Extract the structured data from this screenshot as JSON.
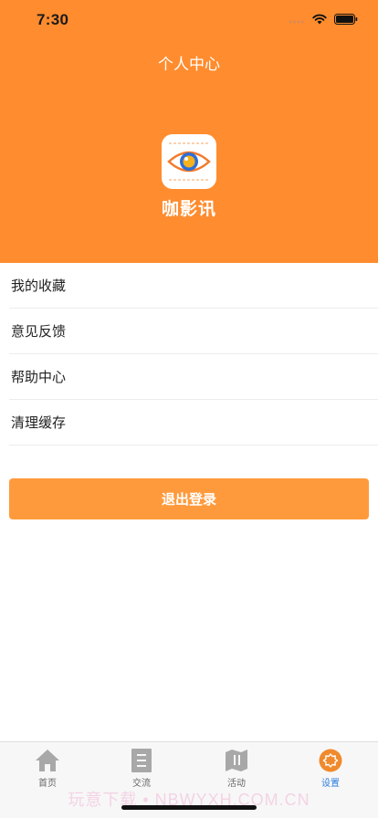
{
  "status_bar": {
    "time": "7:30"
  },
  "header": {
    "title": "个人中心",
    "app_name": "咖影讯"
  },
  "colors": {
    "brand_orange": "#ff8c2e",
    "button_orange": "#ff9a3c",
    "tab_active": "#2b7de0"
  },
  "menu": {
    "items": [
      {
        "label": "我的收藏"
      },
      {
        "label": "意见反馈"
      },
      {
        "label": "帮助中心"
      },
      {
        "label": "清理缓存"
      }
    ]
  },
  "logout_label": "退出登录",
  "tabbar": {
    "tabs": [
      {
        "label": "首页",
        "icon": "home-icon"
      },
      {
        "label": "交流",
        "icon": "document-icon"
      },
      {
        "label": "活动",
        "icon": "map-icon"
      },
      {
        "label": "设置",
        "icon": "settings-icon",
        "active": true
      }
    ]
  },
  "watermark": "玩意下载 • NBWYXH.COM.CN"
}
